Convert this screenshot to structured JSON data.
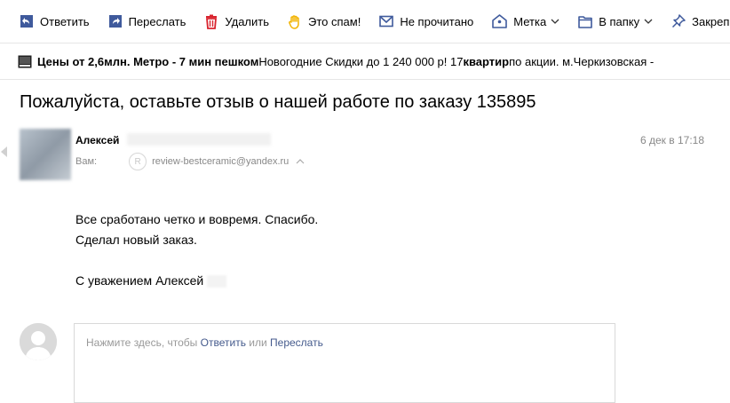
{
  "toolbar": {
    "items": [
      {
        "label": "Ответить",
        "icon": "reply-icon"
      },
      {
        "label": "Переслать",
        "icon": "forward-icon"
      },
      {
        "label": "Удалить",
        "icon": "trash-icon"
      },
      {
        "label": "Это спам!",
        "icon": "spam-hand-icon"
      },
      {
        "label": "Не прочитано",
        "icon": "envelope-icon"
      },
      {
        "label": "Метка",
        "icon": "tag-icon"
      },
      {
        "label": "В папку",
        "icon": "folder-icon"
      },
      {
        "label": "Закрепить",
        "icon": "pin-icon"
      }
    ]
  },
  "ad": {
    "bold1": "Цены от 2,6млн. Метро - 7 мин пешком",
    "text1": " Новогодние Скидки до 1 240 000 р! 17 ",
    "bold2": "квартир",
    "text2": " по акции. м.Черкизовская -"
  },
  "message": {
    "subject": "Пожалуйста, оставьте отзыв о нашей работе по заказу 135895",
    "sender_name": "Алексей",
    "to_label": "Вам:",
    "from_badge": "R",
    "from_address": "review-bestceramic@yandex.ru",
    "date": "6 дек в 17:18",
    "body_line1": "Все сработано четко и вовремя. Спасибо.",
    "body_line2": "Сделал новый заказ.",
    "signature": "С уважением Алексей"
  },
  "reply": {
    "hint_prefix": "Нажмите здесь, чтобы ",
    "reply_link": "Ответить",
    "or_text": " или ",
    "forward_link": "Переслать"
  },
  "colors": {
    "icon_blue": "#3f5a9c",
    "delete_red": "#d9242f",
    "spam_yellow": "#f2b300",
    "link": "#445a8c",
    "muted": "#888888"
  }
}
